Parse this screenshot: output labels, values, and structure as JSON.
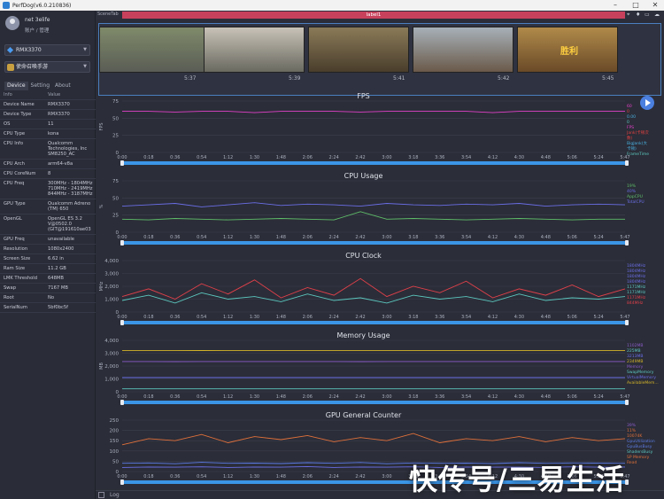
{
  "window": {
    "title": "PerfDog(v6.0.210836)"
  },
  "user": {
    "name": "net 3elife",
    "manager_label": "账户 / 管理"
  },
  "device_selector": {
    "value": "RMX3370"
  },
  "app_selector": {
    "value": "使命召唤手游"
  },
  "tabs": [
    "Device",
    "Setting",
    "About"
  ],
  "props_header": {
    "k": "Info",
    "v": "Value"
  },
  "props": [
    {
      "k": "Device Name",
      "v": "RMX3370"
    },
    {
      "k": "Device Type",
      "v": "RMX3370"
    },
    {
      "k": "OS",
      "v": "11"
    },
    {
      "k": "CPU Type",
      "v": "kona"
    },
    {
      "k": "CPU Info",
      "v": "Qualcomm\nTechnologies, Inc\nSM8250_AC"
    },
    {
      "k": "CPU Arch",
      "v": "arm64-v8a"
    },
    {
      "k": "CPU CoreNum",
      "v": "8"
    },
    {
      "k": "CPU Freq",
      "v": "300MHz - 1804MHz\n710MHz - 2419MHz\n844MHz - 3187MHz"
    },
    {
      "k": "GPU Type",
      "v": "Qualcomm Adreno\n(TM) 650"
    },
    {
      "k": "OpenGL",
      "v": "OpenGL ES 3.2\nV@0502.0\n(GIT@191610ae03"
    },
    {
      "k": "GPU Freq",
      "v": "unavailable"
    },
    {
      "k": "Resolution",
      "v": "1080x2400"
    },
    {
      "k": "Screen Size",
      "v": "6.62 in"
    },
    {
      "k": "Ram Size",
      "v": "11.2 GB"
    },
    {
      "k": "LMK Threshold",
      "v": "648MB"
    },
    {
      "k": "Swap",
      "v": "7167 MB"
    },
    {
      "k": "Root",
      "v": "No"
    },
    {
      "k": "SerialNum",
      "v": "5bf0bc5f"
    }
  ],
  "scene": {
    "tab_label": "SceneTab",
    "label": "label1"
  },
  "thumbnails": [
    {
      "time": "5:37"
    },
    {
      "time": "5:39"
    },
    {
      "time": "5:41"
    },
    {
      "time": "5:42"
    },
    {
      "time": "5:45"
    }
  ],
  "thumb_overlay": {
    "victory_text": "胜利"
  },
  "x_ticks": [
    "0:00",
    "0:18",
    "0:36",
    "0:54",
    "1:12",
    "1:30",
    "1:48",
    "2:06",
    "2:24",
    "2:42",
    "3:00",
    "3:18",
    "3:36",
    "3:54",
    "4:12",
    "4:30",
    "4:48",
    "5:06",
    "5:24",
    "5:47"
  ],
  "charts": [
    {
      "title": "FPS",
      "ylabel": "FPS",
      "yticks": [
        "75",
        "50",
        "25",
        "0"
      ],
      "legend_values": [
        "60",
        "0",
        "0.00",
        "0"
      ],
      "legend": [
        "FPS",
        "Jank(卡顿次数)",
        "BigJank(大卡顿)",
        "FrameTime"
      ]
    },
    {
      "title": "CPU Usage",
      "ylabel": "%",
      "yticks": [
        "75",
        "50",
        "25",
        "0"
      ],
      "legend_values": [
        "19%",
        "40%"
      ],
      "legend": [
        "AppCPU",
        "TotalCPU"
      ]
    },
    {
      "title": "CPU Clock",
      "ylabel": "MHz",
      "yticks": [
        "4,000",
        "3,000",
        "2,000",
        "1,000",
        "0"
      ],
      "legend": [
        "1804MHz",
        "1804MHz",
        "1804MHz",
        "1804MHz",
        "1171MHz",
        "1171MHz",
        "1171MHz",
        "844MHz"
      ]
    },
    {
      "title": "Memory Usage",
      "ylabel": "MB",
      "yticks": [
        "4,000",
        "3,000",
        "2,000",
        "1,000",
        "0"
      ],
      "legend": [
        "1102MB",
        "225MB",
        "3213MB",
        "2349MB",
        "Memory",
        "SwapMemory",
        "VirtualMemory",
        "AvailableMem..."
      ]
    },
    {
      "title": "GPU General Counter",
      "ylabel": "",
      "yticks": [
        "250",
        "200",
        "150",
        "100",
        "50",
        "0"
      ],
      "legend": [
        "39%",
        "11%",
        "10074K",
        "GpuUtilization",
        "GpuBusBusy",
        "ShadersBusy",
        "SP Memory Read"
      ]
    }
  ],
  "bottom": {
    "log": "Log"
  },
  "watermark": "快传号/三易生活",
  "colors": {
    "fps": "#e040c8",
    "app_cpu": "#5fbf6a",
    "total_cpu": "#6a6ee6",
    "clock_red": "#e0404a",
    "clock_teal": "#5cc8c0",
    "mem_yellow": "#d4b428",
    "mem_purple": "#8a5cc8",
    "gpu_orange": "#e0703a",
    "gpu_blue": "#5c7ce6"
  },
  "chart_data": [
    {
      "type": "line",
      "title": "FPS",
      "ylabel": "FPS",
      "ylim": [
        0,
        75
      ],
      "series": [
        {
          "name": "FPS",
          "values": [
            60,
            60,
            59,
            60,
            60,
            58,
            60,
            60,
            60,
            59,
            60,
            60,
            60,
            60,
            58,
            60,
            60,
            60,
            60,
            60
          ]
        }
      ]
    },
    {
      "type": "line",
      "title": "CPU Usage",
      "ylabel": "%",
      "ylim": [
        0,
        75
      ],
      "series": [
        {
          "name": "TotalCPU",
          "values": [
            38,
            40,
            42,
            37,
            40,
            43,
            39,
            41,
            40,
            38,
            42,
            40,
            39,
            41,
            40,
            42,
            38,
            40,
            41,
            40
          ]
        },
        {
          "name": "AppCPU",
          "values": [
            19,
            18,
            20,
            19,
            18,
            19,
            20,
            19,
            18,
            30,
            19,
            20,
            19,
            18,
            19,
            20,
            19,
            18,
            19,
            19
          ]
        }
      ]
    },
    {
      "type": "line",
      "title": "CPU Clock",
      "ylabel": "MHz",
      "ylim": [
        0,
        4000
      ],
      "series": [
        {
          "name": "Big",
          "values": [
            1200,
            1800,
            1000,
            2200,
            1400,
            2500,
            1100,
            1900,
            1300,
            2600,
            1200,
            2000,
            1500,
            2400,
            1100,
            1800,
            1300,
            2100,
            1200,
            1800
          ]
        },
        {
          "name": "Little",
          "values": [
            900,
            1300,
            700,
            1500,
            1000,
            1200,
            800,
            1400,
            900,
            1100,
            700,
            1300,
            1000,
            1200,
            800,
            1400,
            900,
            1100,
            1000,
            1200
          ]
        }
      ]
    },
    {
      "type": "line",
      "title": "Memory Usage",
      "ylabel": "MB",
      "ylim": [
        0,
        4000
      ],
      "series": [
        {
          "name": "Memory",
          "values": [
            3213,
            3213,
            3215,
            3210,
            3214,
            3213,
            3213,
            3212,
            3214,
            3213,
            3213,
            3213,
            3214,
            3213,
            3213,
            3213,
            3213,
            3213,
            3213,
            3213
          ]
        },
        {
          "name": "AvailableMem",
          "values": [
            2349,
            2350,
            2348,
            2350,
            2349,
            2349,
            2350,
            2349,
            2349,
            2348,
            2349,
            2350,
            2349,
            2349,
            2349,
            2350,
            2349,
            2349,
            2349,
            2349
          ]
        },
        {
          "name": "SwapMemory",
          "values": [
            1102,
            1102,
            1102,
            1102,
            1102,
            1102,
            1102,
            1102,
            1102,
            1102,
            1102,
            1102,
            1102,
            1102,
            1102,
            1102,
            1102,
            1102,
            1102,
            1102
          ]
        },
        {
          "name": "VirtualMemory",
          "values": [
            225,
            225,
            225,
            225,
            225,
            225,
            225,
            225,
            225,
            225,
            225,
            225,
            225,
            225,
            225,
            225,
            225,
            225,
            225,
            225
          ]
        }
      ]
    },
    {
      "type": "line",
      "title": "GPU General Counter",
      "ylim": [
        0,
        250
      ],
      "series": [
        {
          "name": "GpuUtilization",
          "values": [
            130,
            160,
            150,
            180,
            140,
            170,
            155,
            175,
            145,
            165,
            150,
            185,
            140,
            160,
            150,
            170,
            145,
            165,
            150,
            160
          ]
        },
        {
          "name": "GpuBusBusy",
          "values": [
            40,
            42,
            38,
            45,
            40,
            41,
            39,
            43,
            40,
            44,
            38,
            42,
            40,
            41,
            39,
            43,
            40,
            42,
            41,
            40
          ]
        },
        {
          "name": "ShadersBusy",
          "values": [
            20,
            22,
            21,
            23,
            20,
            22,
            21,
            24,
            20,
            22,
            21,
            23,
            20,
            22,
            21,
            22,
            20,
            23,
            21,
            22
          ]
        }
      ]
    }
  ]
}
